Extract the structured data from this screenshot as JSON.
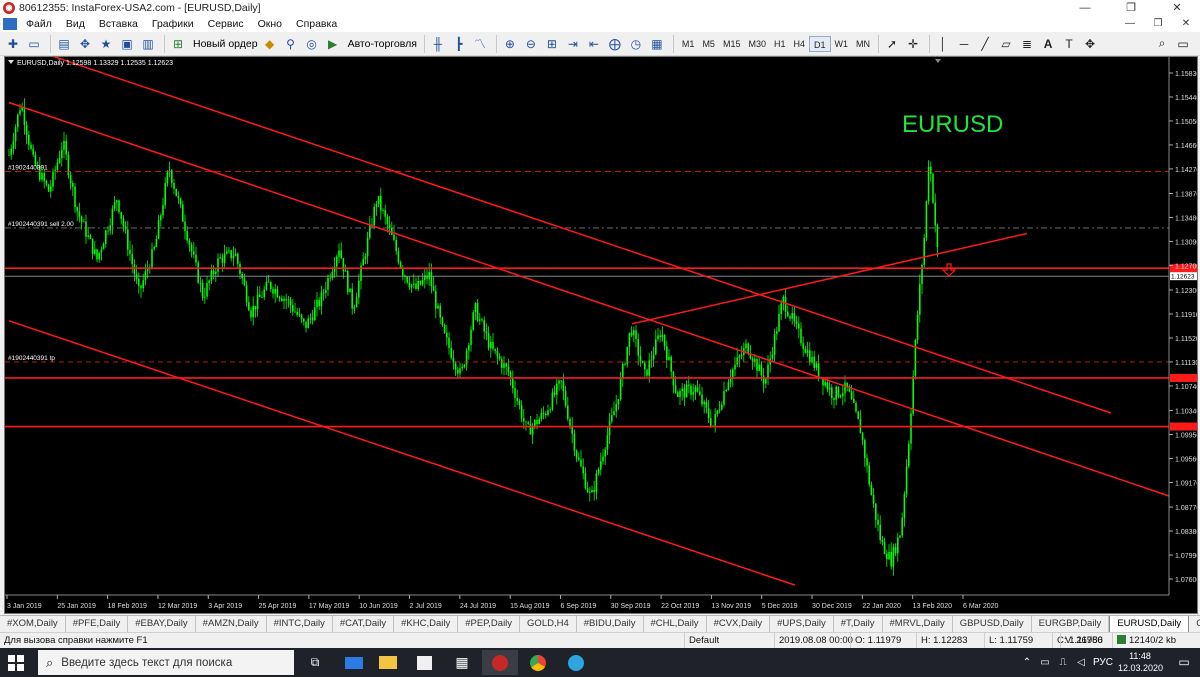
{
  "window": {
    "title": "80612355: InstaForex-USA2.com - [EURUSD,Daily]",
    "minimize": "—",
    "restore": "❐",
    "close": "✕"
  },
  "menu": {
    "items": [
      "Файл",
      "Вид",
      "Вставка",
      "Графики",
      "Сервис",
      "Окно",
      "Справка"
    ],
    "mdi_minimize": "—",
    "mdi_restore": "❐",
    "mdi_close": "✕"
  },
  "toolbar": {
    "new_order": "Новый ордер",
    "auto_trading": "Авто-торговля",
    "timeframes": [
      "M1",
      "M5",
      "M15",
      "M30",
      "H1",
      "H4",
      "D1",
      "W1",
      "MN"
    ],
    "active_timeframe": "D1"
  },
  "chart": {
    "info": "EURUSD,Daily  1.12598 1.13329 1.12535 1.12623",
    "symbol_label": "EURUSD",
    "order_labels": {
      "order_line": "#1902440391",
      "sell_line": "#1902440391 sell 2.00",
      "tp_line": "#1902440391 tp"
    },
    "price_ticks": [
      "1.15830",
      "1.15440",
      "1.15050",
      "1.14660",
      "1.14270",
      "1.13870",
      "1.13480",
      "1.13090",
      "1.12700",
      "1.12300",
      "1.11910",
      "1.11520",
      "1.11130",
      "1.10740",
      "1.10340",
      "1.09950",
      "1.09560",
      "1.09170",
      "1.08770",
      "1.08380",
      "1.07990",
      "1.07600"
    ],
    "current_price": "1.12623",
    "date_ticks": [
      "3 Jan 2019",
      "25 Jan 2019",
      "18 Feb 2019",
      "12 Mar 2019",
      "3 Apr 2019",
      "25 Apr 2019",
      "17 May 2019",
      "10 Jun 2019",
      "2 Jul 2019",
      "24 Jul 2019",
      "15 Aug 2019",
      "6 Sep 2019",
      "30 Sep 2019",
      "22 Oct 2019",
      "13 Nov 2019",
      "5 Dec 2019",
      "30 Dec 2019",
      "22 Jan 2020",
      "13 Feb 2020",
      "6 Mar 2020"
    ],
    "colors": {
      "background": "#000000",
      "candles": "#00ff00",
      "lines": "#ff1a1a",
      "symbol_label": "#23e23c"
    }
  },
  "tabs": {
    "items": [
      "#XOM,Daily",
      "#PFE,Daily",
      "#EBAY,Daily",
      "#AMZN,Daily",
      "#INTC,Daily",
      "#CAT,Daily",
      "#KHC,Daily",
      "#PEP,Daily",
      "GOLD,H4",
      "#BIDU,Daily",
      "#CHL,Daily",
      "#CVX,Daily",
      "#UPS,Daily",
      "#T,Daily",
      "#MRVL,Daily",
      "GBPUSD,Daily",
      "EURGBP,Daily",
      "EURUSD,Daily",
      "GBPJPY,"
    ],
    "active": "EURUSD,Daily"
  },
  "status": {
    "help": "Для вызова справки нажмите F1",
    "profile": "Default",
    "datetime": "2019.08.08 00:00",
    "open": "O: 1.11979",
    "high": "H: 1.12283",
    "low": "L: 1.11759",
    "close": "C: 1.11786",
    "volume": "V: 26950",
    "traffic": "12140/2 kb"
  },
  "taskbar": {
    "search_placeholder": "Введите здесь текст для поиска",
    "lang": "РУС",
    "time": "11:48",
    "date": "12.03.2020"
  }
}
